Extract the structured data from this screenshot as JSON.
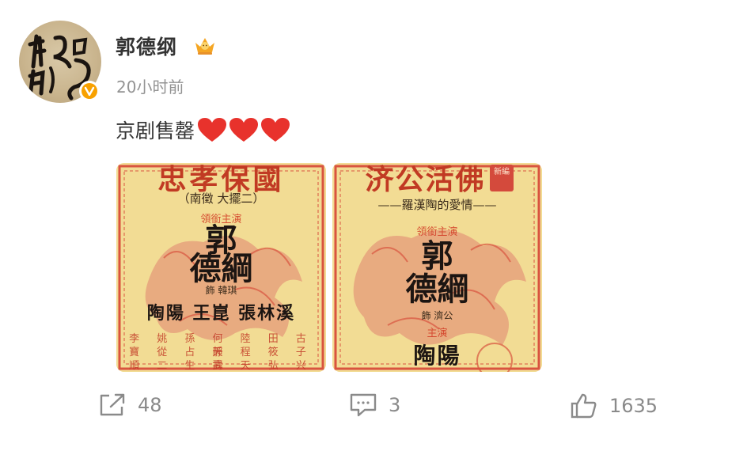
{
  "post": {
    "author": "郭德纲",
    "timestamp": "20小时前",
    "text": "京剧售罄",
    "hearts_count": 3
  },
  "poster_1": {
    "title": "忠孝保國",
    "subtitle": "（南徵 大擺二）",
    "role_label": "領銜主演",
    "name_line1": "郭",
    "name_line2": "德綱",
    "role_small": "飾 韓琪",
    "cast": "陶陽  王崑  張林溪",
    "grid_row1": "李  姚  孫  何  陸  田  古  天",
    "grid_row2": "寶  從  占  靜  程  筱  子  武",
    "grid_row3": "順  二  生  壽  天  弘  兴  姓"
  },
  "poster_2": {
    "title": "济公活佛",
    "tag": "新編",
    "subtitle": "——羅漢陶的愛情——",
    "role_label": "領銜主演",
    "name_line1": "郭",
    "name_line2": "德綱",
    "role_small": "飾 濟公",
    "role_label_2": "主演",
    "cast": "陶陽"
  },
  "actions": {
    "share_count": "48",
    "comment_count": "3",
    "like_count": "1635"
  },
  "colors": {
    "accent_red": "#e8322c",
    "text_primary": "#333333",
    "text_secondary": "#939393",
    "verified_badge": "#f8a100"
  },
  "icons": [
    "verified-badge-icon",
    "crown-badge-icon",
    "heart-icon",
    "share-icon",
    "comment-icon",
    "like-icon"
  ]
}
